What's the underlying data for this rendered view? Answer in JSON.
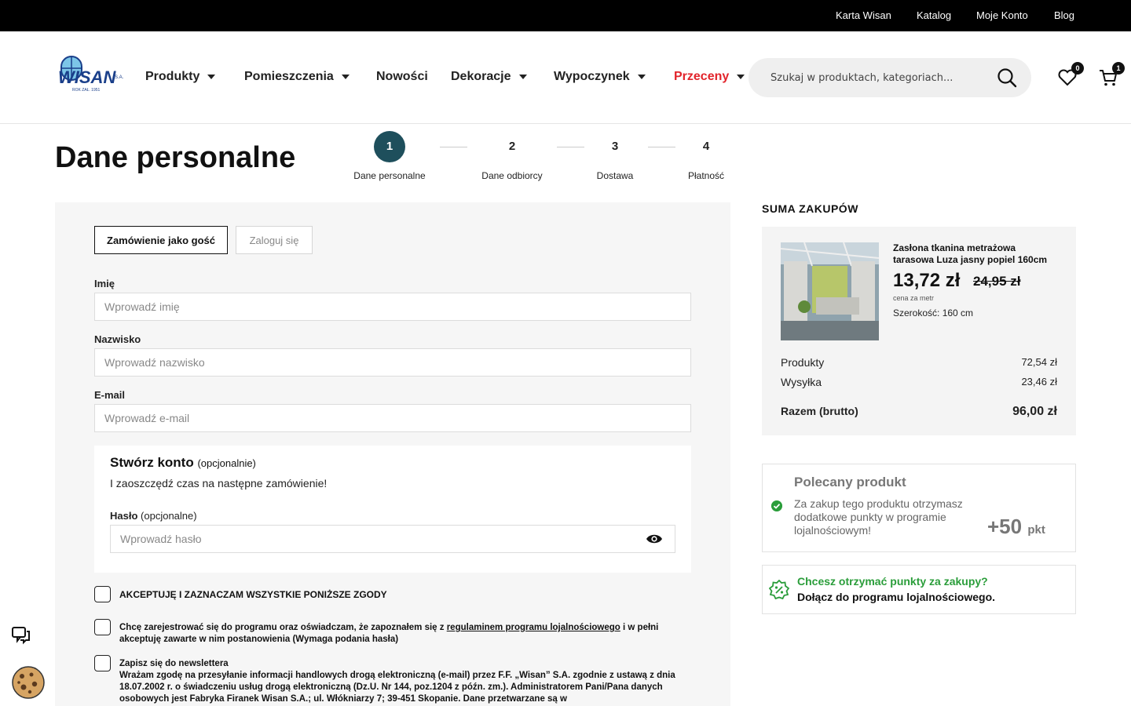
{
  "topbar": {
    "links": [
      "Karta Wisan",
      "Katalog",
      "Moje Konto",
      "Blog"
    ]
  },
  "logo": {
    "text": "WISAN",
    "suffix": "S.A.",
    "tagline": "ROK ZAŁ. 1951"
  },
  "nav": {
    "items": [
      "Produkty",
      "Pomieszczenia",
      "Nowości",
      "Dekoracje",
      "Wypoczynek",
      "Przeceny"
    ]
  },
  "search": {
    "placeholder": "Szukaj w produktach, kategoriach..."
  },
  "header_icons": {
    "wishlist_count": "0",
    "cart_count": "1"
  },
  "page": {
    "title": "Dane personalne"
  },
  "steps": [
    {
      "num": "1",
      "label": "Dane personalne"
    },
    {
      "num": "2",
      "label": "Dane odbiorcy"
    },
    {
      "num": "3",
      "label": "Dostawa"
    },
    {
      "num": "4",
      "label": "Płatność"
    }
  ],
  "form": {
    "tabs": {
      "guest": "Zamówienie jako gość",
      "login": "Zaloguj się"
    },
    "first_name": {
      "label": "Imię",
      "placeholder": "Wprowadź imię"
    },
    "last_name": {
      "label": "Nazwisko",
      "placeholder": "Wprowadź nazwisko"
    },
    "email": {
      "label": "E-mail",
      "placeholder": "Wprowadź e-mail"
    },
    "account": {
      "title": "Stwórz konto",
      "optional": "(opcjonalnie)",
      "subtitle": "I zaoszczędź czas na następne zamówienie!",
      "password_label": "Hasło",
      "password_optional": "(opcjonalne)",
      "password_placeholder": "Wprowadź hasło"
    },
    "consents": {
      "all": "AKCEPTUJĘ I ZAZNACZAM WSZYSTKIE PONIŻSZE ZGODY",
      "loyalty_pre": "Chcę zarejestrować się do programu oraz oświadczam, że zapoznałem się z ",
      "loyalty_link": "regulaminem programu lojalnościowego",
      "loyalty_post": " i w pełni akceptuję zawarte w nim postanowienia (Wymaga podania hasła)",
      "newsletter_title": "Zapisz się do newslettera",
      "newsletter_text": "Wrażam zgodę na przesyłanie informacji handlowych drogą elektroniczną (e-mail) przez F.F. „Wisan” S.A. zgodnie z ustawą z dnia 18.07.2002 r. o świadczeniu usług drogą elektroniczną (Dz.U. Nr 144, poz.1204 z późn. zm.). Administratorem Pani/Pana danych osobowych jest Fabryka Firanek Wisan S.A.; ul. Włókniarzy 7; 39-451 Skopanie. Dane przetwarzane są w"
    }
  },
  "summary": {
    "heading": "SUMA ZAKUPÓW",
    "product": {
      "name": "Zasłona tkanina metrażowa tarasowa Luza jasny popiel 160cm",
      "price": "13,72 zł",
      "old_price": "24,95 zł",
      "unit": "cena za metr",
      "width": "Szerokość: 160 cm"
    },
    "products_label": "Produkty",
    "products_value": "72,54 zł",
    "shipping_label": "Wysyłka",
    "shipping_value": "23,46 zł",
    "total_label": "Razem (brutto)",
    "total_value": "96,00 zł"
  },
  "recommended": {
    "title": "Polecany produkt",
    "text": "Za zakup tego produktu otrzymasz dodatkowe punkty w programie lojalnościowym!",
    "points": "+50",
    "points_unit": "pkt"
  },
  "loyalty": {
    "question": "Chcesz otrzymać punkty za zakupy?",
    "cta": "Dołącz do programu lojalnościowego."
  },
  "colors": {
    "step_active": "#1e4f5c",
    "sale": "#e2242b",
    "loyalty_green": "#2a9d3a"
  }
}
